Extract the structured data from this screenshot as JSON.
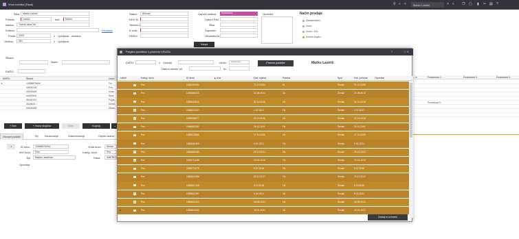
{
  "app": {
    "title": "Vnos bolnika (Tisak)"
  },
  "toolbar": {
    "sel_label": "Marko Lastrić",
    "nav": [
      "«",
      "<",
      ">",
      "»"
    ]
  },
  "form": {
    "sifra_label": "Šifra",
    "sifra": "Marko Lastrić",
    "priimek_label": "Priimek",
    "priimek": "Lastrič",
    "ime_label": "Ime",
    "ime": "Marko",
    "naslov_label": "Naslov",
    "naslov": "Trstnik ulica 1/b",
    "drzava_label": "Država",
    "drzava_link": "Hrvatska",
    "posta_label": "Pošta",
    "posta": "1000",
    "posta_city": "Ljubljana - dostava",
    "obcina_label": "Občina",
    "obcina": "061",
    "obcina_city": "Ljubljana",
    "status_label": "Status",
    "status": "Aktivan",
    "ddv_label": "DDV št.",
    "telefon_label": "Telefon 2",
    "email_label": "E-mail",
    "emso_label": "EMŠO",
    "zadnja_label": "Odprta zadeva",
    "zadnja": "Dokument",
    "datum_label": "Datum Rež.",
    "sifra2_label": "Šifra",
    "zaposlitve_label": "Zaposlen",
    "obvestila_label": "Obvestila št.",
    "opombe_label": "Opombe",
    "sifrant_label": "Šifrant",
    "naziv_label": "Naziv",
    "emso2_label": "EMŠO",
    "vstopi_btn": "Vstopi"
  },
  "nacin": {
    "title": "Način prodaje",
    "options": [
      "Zavarovanec",
      "Izvoz",
      "Izvoz – EU",
      "Končni kupec"
    ],
    "selected": 3
  },
  "left_grid": {
    "headers": [
      "EMŠO",
      "Šifrant",
      "Naziv"
    ],
    "rows": [
      [
        "",
        "12598875434",
        "Fiz."
      ],
      [
        "",
        "44002235",
        "Pvs."
      ],
      [
        "",
        "44002545",
        "Vosa."
      ],
      [
        "",
        "44002542",
        "Sera."
      ],
      [
        "",
        "30432122",
        "Pojas."
      ],
      [
        "",
        "3023643",
        "Smed."
      ],
      [
        "",
        "54433458",
        "Marco"
      ]
    ]
  },
  "left_buttons": {
    "new": "+ Nov",
    "new_group": "+ Nova skupina",
    "delete": "Briši",
    "copy": "Kopiraj",
    "arrow": "→"
  },
  "tabs": [
    "Osnovni podatki",
    "Rp",
    "Zavarovanje",
    "Dokumentacija",
    "Odprte zadeve"
  ],
  "bottom": {
    "id_label": "ID šuvo",
    "id": "12598875434",
    "vrsta_label": "Vrsta šuvo",
    "vrsta": "Mesto",
    "ime_label": "Ime šuvo",
    "ime": "Fido",
    "kateg_label": "Kateg. šuvo",
    "kateg": "Pes",
    "tip_label": "Tipi",
    "tip": "Mačka, kastriran",
    "rasa_label": "Rasa",
    "rasa": "AMERICAN",
    "opomba_label": "Opomba"
  },
  "right_grid": {
    "headers": [
      "…e",
      "Posebnost 1",
      "Posebnost 2",
      "Posebnost 3"
    ],
    "row2_val": "Posebnost 5"
  },
  "dialog": {
    "title": "Pregled podatkov v prometu VSUDA",
    "emso_label": "EMŠO",
    "vpisni_label": "Vpisnik",
    "geslo_label": "Geslo",
    "geslo": "**********",
    "datum_label": "Datum vpisne pd",
    "do_label": "do",
    "btn_prev": "Prenesi podatke",
    "person": "Marko Lastrič",
    "headers": [
      "Izberi",
      "Kateg. šuvo",
      "ID šuvo",
      "▲ Ime",
      "Dat. rojstva",
      "Pasma",
      "Spol",
      "Dat. prihoda",
      "Opomba"
    ],
    "rows": [
      [
        "Pes",
        "1084000094",
        "21.10.2004",
        "Ej",
        "Ženski",
        "21.10.2004"
      ],
      [
        "Pes",
        "1084688415",
        "21.08.2013",
        "Ok",
        "Ženski",
        "21.08.2013"
      ],
      [
        "Pes",
        "1084610510",
        "31.10.2016",
        "Ok",
        "Ženski",
        "31.10.2016"
      ],
      [
        "Pes",
        "1084512207",
        "1.07.2017",
        "Ok",
        "Ženski",
        "1.07.2017"
      ],
      [
        "Pes",
        "1085155577",
        "22.12.2016",
        "Ok",
        "Ženski",
        "22.12.2016"
      ],
      [
        "Pes",
        "1084553351",
        "20.11.2001",
        "Ok",
        "Ženski",
        "20.11.2001"
      ],
      [
        "Pes",
        "1485112866",
        "17.10.2020",
        "Ok",
        "Ženski",
        "17.10.2020"
      ],
      [
        "Pes",
        "1084646309",
        "0.01.2021",
        "Ok",
        "Ženski",
        "0.01.2021"
      ],
      [
        "Pes",
        "1084646189",
        "20.12.2021",
        "Ok",
        "Ženski",
        "20.12.2021"
      ],
      [
        "Pes",
        "1094771186",
        "22.01.2016",
        "Ok",
        "Ženski",
        "22.01.2016"
      ],
      [
        "Pes",
        "1084771178",
        "9.07.2016",
        "Ok",
        "Ženski",
        "9.07.2016"
      ],
      [
        "Pes",
        "1084842256",
        "20.12.2017",
        "Ok",
        "Ženski",
        "20.12.2017"
      ],
      [
        "Pes",
        "1084537416",
        "6.12.2018",
        "Ok",
        "Ženski",
        "6.12.2018"
      ],
      [
        "Pes",
        "1085461397",
        "9.02.2021",
        "Ok",
        "Ženski",
        "9.02.2021"
      ],
      [
        "Pes",
        "1085461414",
        "30.08.2021",
        "Ok",
        "Ženski",
        "30.08.2021"
      ],
      [
        "Pes",
        "1084461642",
        "30.01.2021",
        "Ok",
        "Ženski",
        "15.01.2021"
      ]
    ],
    "btn_ok": "Dodaj in prenesi"
  },
  "colors": {
    "row": "#c08a28",
    "accent": "#f3b21b",
    "dark": "#34343c",
    "pink": "#c64ea8"
  }
}
